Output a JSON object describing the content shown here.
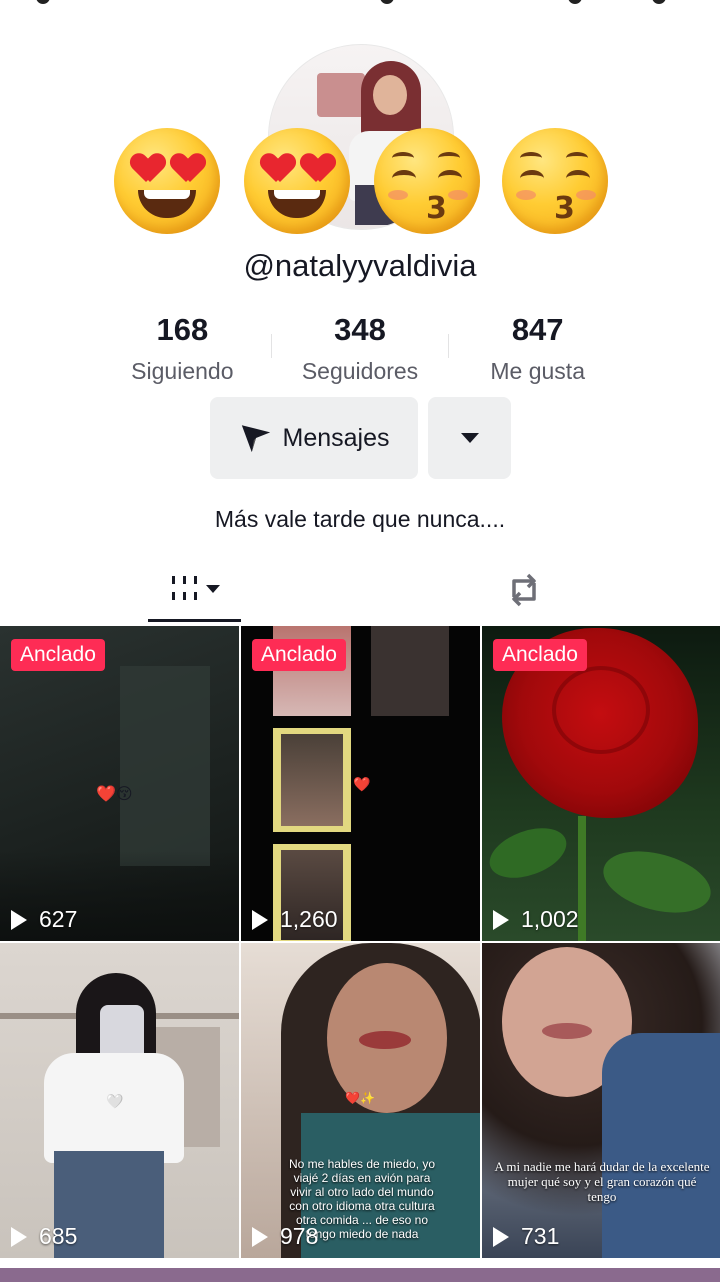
{
  "profile": {
    "username": "@natalyyvaldivia",
    "emojis": [
      "heart-eyes",
      "heart-eyes",
      "kissing",
      "kissing"
    ],
    "bio": "Más vale tarde que nunca....",
    "stats": [
      {
        "value": "168",
        "label": "Siguiendo"
      },
      {
        "value": "348",
        "label": "Seguidores"
      },
      {
        "value": "847",
        "label": "Me gusta"
      }
    ]
  },
  "actions": {
    "message_label": "Mensajes",
    "more_icon": "chevron-down-icon"
  },
  "tabs": {
    "videos_icon": "grid-icon",
    "reposts_icon": "repost-icon"
  },
  "colors": {
    "accent": "#fe2c55",
    "button_bg": "#eeeff0",
    "text": "#161823",
    "secondary_text": "#5b5c66"
  },
  "videos": [
    {
      "pinned_label": "Anclado",
      "views": "627"
    },
    {
      "pinned_label": "Anclado",
      "views": "1,260"
    },
    {
      "pinned_label": "Anclado",
      "views": "1,002"
    },
    {
      "pinned_label": "",
      "views": "685"
    },
    {
      "pinned_label": "",
      "views": "978",
      "caption": "No me hables de miedo, yo viajé 2 días en avión para vivir al otro lado del mundo con otro idioma otra cultura otra comida ... de eso no tengo miedo de nada"
    },
    {
      "pinned_label": "",
      "views": "731",
      "caption": "A mi nadie me hará dudar de la excelente mujer qué soy y el gran corazón qué tengo"
    }
  ]
}
